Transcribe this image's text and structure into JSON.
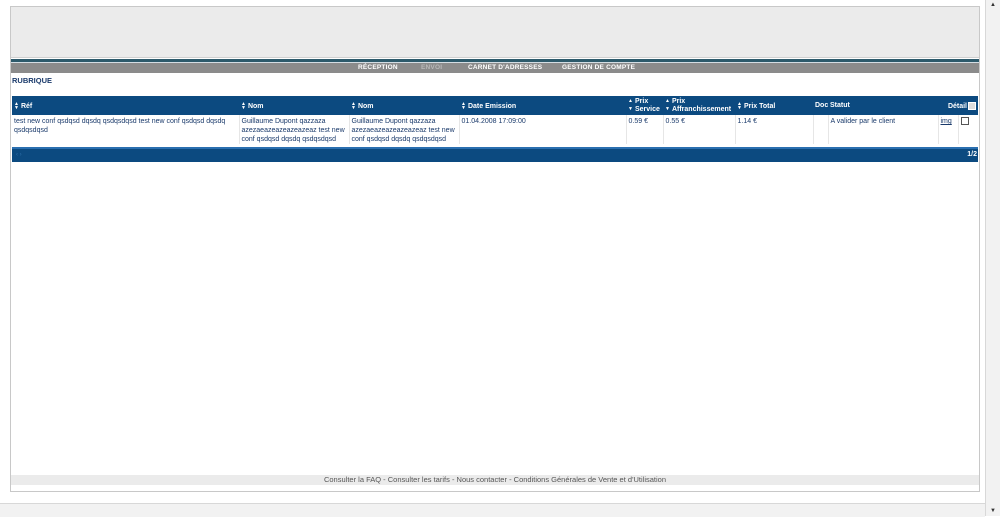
{
  "menu": {
    "items": [
      {
        "label": "RÉCEPTION"
      },
      {
        "label": "ENVOI"
      },
      {
        "label": "CARNET D'ADRESSES"
      },
      {
        "label": "GESTION DE COMPTE"
      }
    ]
  },
  "section": {
    "title": "RUBRIQUE"
  },
  "table": {
    "headers": {
      "ref": "Réf",
      "nom1": "Nom",
      "nom2": "Nom",
      "date": "Date Emission",
      "prix_service_1": "Prix",
      "prix_service_2": "Service",
      "prix_affr_1": "Prix",
      "prix_affr_2": "Affranchissement",
      "prix_total": "Prix Total",
      "doc": "Doc",
      "statut": "Statut",
      "detail": "Détail"
    },
    "row": {
      "ref": "test new conf qsdqsd dqsdq qsdqsdqsd test new conf qsdqsd dqsdq qsdqsdqsd",
      "nom1": "Guillaume Dupont qazzaza azezaeazeazeazeazeaz test new conf qsdqsd dqsdq qsdqsdqsd",
      "nom2": "Guillaume Dupont qazzaza azezaeazeazeazeazeaz test new conf qsdqsd dqsdq qsdqsdqsd",
      "date": "01.04.2008 17:09:00",
      "prix_service": "0.59 €",
      "prix_affr": "0.55 €",
      "prix_total": "1.14 €",
      "doc": "",
      "statut": "A valider par le client",
      "detail_link": "img"
    }
  },
  "pager": {
    "nav": "‹ ›",
    "page": "1/2"
  },
  "footer": {
    "links": [
      "Consulter la FAQ",
      "Consulter les tarifs",
      "Nous contacter",
      "Conditions Générales de Vente et d'Utilisation"
    ],
    "separator": " - "
  }
}
